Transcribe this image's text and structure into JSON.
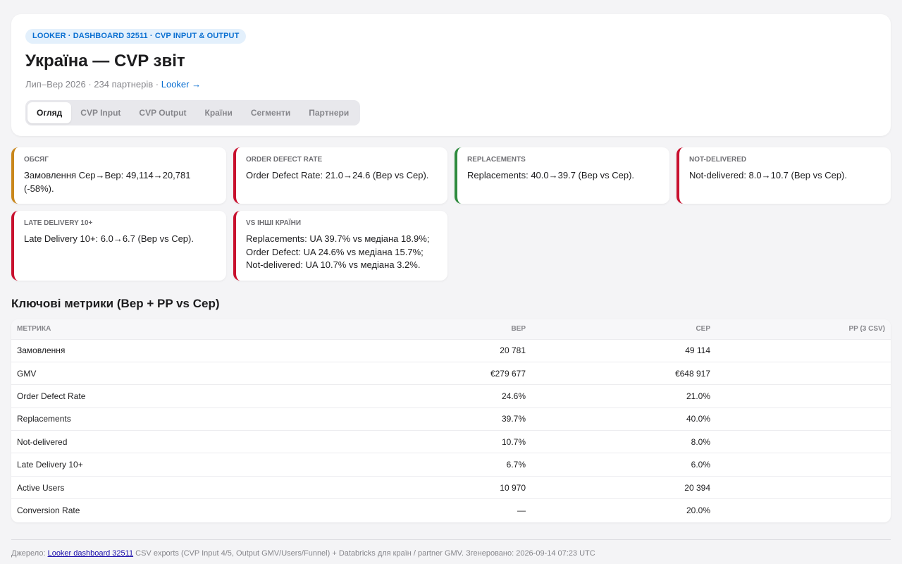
{
  "header": {
    "badge": "LOOKER · DASHBOARD 32511 · CVP INPUT & OUTPUT",
    "title": "Україна — CVP звіт",
    "subtitle_text": "Лип–Вер 2026 · 234 партнерів · ",
    "subtitle_link": "Looker →",
    "tabs": [
      {
        "label": "Огляд",
        "active": true
      },
      {
        "label": "CVP Input"
      },
      {
        "label": "CVP Output"
      },
      {
        "label": "Країни"
      },
      {
        "label": "Сегменти"
      },
      {
        "label": "Партнери"
      }
    ]
  },
  "kpis": [
    {
      "label": "ОБСЯГ",
      "text": "Замовлення Сер→Вер: 49,114→20,781 (-58%).",
      "color": "#c9871c"
    },
    {
      "label": "ORDER DEFECT RATE",
      "text": "Order Defect Rate: 21.0→24.6 (Вер vs Сер).",
      "color": "#c8102e"
    },
    {
      "label": "REPLACEMENTS",
      "text": "Replacements: 40.0→39.7 (Вер vs Сер).",
      "color": "#2e8b3e"
    },
    {
      "label": "NOT-DELIVERED",
      "text": "Not-delivered: 8.0→10.7 (Вер vs Сер).",
      "color": "#c8102e"
    },
    {
      "label": "LATE DELIVERY 10+",
      "text": "Late Delivery 10+: 6.0→6.7 (Вер vs Сер).",
      "color": "#c8102e"
    },
    {
      "label": "VS ІНШІ КРАЇНИ",
      "text": "Replacements: UA 39.7% vs медіана 18.9%; Order Defect: UA 24.6% vs медіана 15.7%; Not-delivered: UA 10.7% vs медіана 3.2%.",
      "color": "#c8102e"
    }
  ],
  "metrics": {
    "title": "Ключові метрики (Вер + PP vs Сер)",
    "columns": [
      "МЕТРИКА",
      "ВЕР",
      "СЕР",
      "PP (3 CSV)"
    ],
    "rows": [
      [
        "Замовлення",
        "20 781",
        "49 114",
        ""
      ],
      [
        "GMV",
        "€279 677",
        "€648 917",
        ""
      ],
      [
        "Order Defect Rate",
        "24.6%",
        "21.0%",
        ""
      ],
      [
        "Replacements",
        "39.7%",
        "40.0%",
        ""
      ],
      [
        "Not-delivered",
        "10.7%",
        "8.0%",
        ""
      ],
      [
        "Late Delivery 10+",
        "6.7%",
        "6.0%",
        ""
      ],
      [
        "Active Users",
        "10 970",
        "20 394",
        ""
      ],
      [
        "Conversion Rate",
        "—",
        "20.0%",
        ""
      ]
    ]
  },
  "footer": {
    "prefix": "Джерело: ",
    "link": "Looker dashboard 32511",
    "suffix": " CSV exports (CVP Input 4/5, Output GMV/Users/Funnel) + Databricks для країн / partner GMV. Згенеровано: 2026-09-14 07:23 UTC"
  }
}
